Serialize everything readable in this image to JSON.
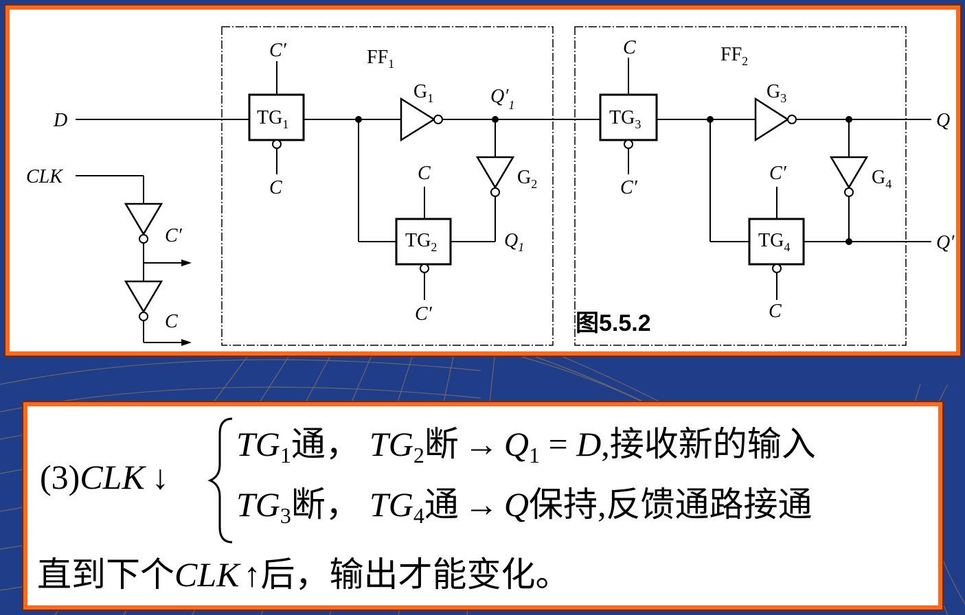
{
  "diagram": {
    "inputs": {
      "d": "D",
      "clk": "CLK"
    },
    "outputs": {
      "q": "Q",
      "q_bar": "Q′"
    },
    "clock_gen": {
      "c_prime": "C′",
      "c": "C"
    },
    "ff1": {
      "title_main": "FF",
      "title_sub": "1",
      "tg1": {
        "main": "TG",
        "sub": "1",
        "top": "C′",
        "bottom": "C"
      },
      "g1": {
        "main": "G",
        "sub": "1"
      },
      "g2": {
        "main": "G",
        "sub": "2"
      },
      "q1_prime": {
        "main": "Q′",
        "sub": "1"
      },
      "tg2": {
        "main": "TG",
        "sub": "2",
        "top": "C",
        "bottom": "C′"
      },
      "q1": {
        "main": "Q",
        "sub": "1"
      }
    },
    "ff2": {
      "title_main": "FF",
      "title_sub": "2",
      "tg3": {
        "main": "TG",
        "sub": "3",
        "top": "C",
        "bottom": "C′"
      },
      "g3": {
        "main": "G",
        "sub": "3"
      },
      "g4": {
        "main": "G",
        "sub": "4"
      },
      "tg4": {
        "main": "TG",
        "sub": "4",
        "top": "C′",
        "bottom": "C"
      }
    },
    "figure_label": "图5.5.2"
  },
  "explanation": {
    "prefix": "(3)",
    "clk": "CLK",
    "down_arrow": "↓",
    "line1": {
      "a_main": "TG",
      "a_sub": "1",
      "a_state": "通，",
      "b_main": "TG",
      "b_sub": "2",
      "b_state": "断",
      "arrow": "→",
      "eq_q": "Q",
      "eq_q_sub": "1",
      "eq_rest": " = ",
      "eq_d": "D",
      "tail": ",接收新的输入"
    },
    "line2": {
      "a_main": "TG",
      "a_sub": "3",
      "a_state": "断，",
      "b_main": "TG",
      "b_sub": "4",
      "b_state": "通",
      "arrow": "→",
      "q": "Q",
      "tail": "保持,反馈通路接通"
    },
    "bottom": {
      "pre": "直到下个",
      "clk": "CLK",
      "up_arrow": "↑",
      "post": "后，输出才能变化。"
    }
  },
  "colors": {
    "background": "#1f3d88",
    "panel_border": "#ff6a1a",
    "panel_fill": "#ffffff"
  }
}
